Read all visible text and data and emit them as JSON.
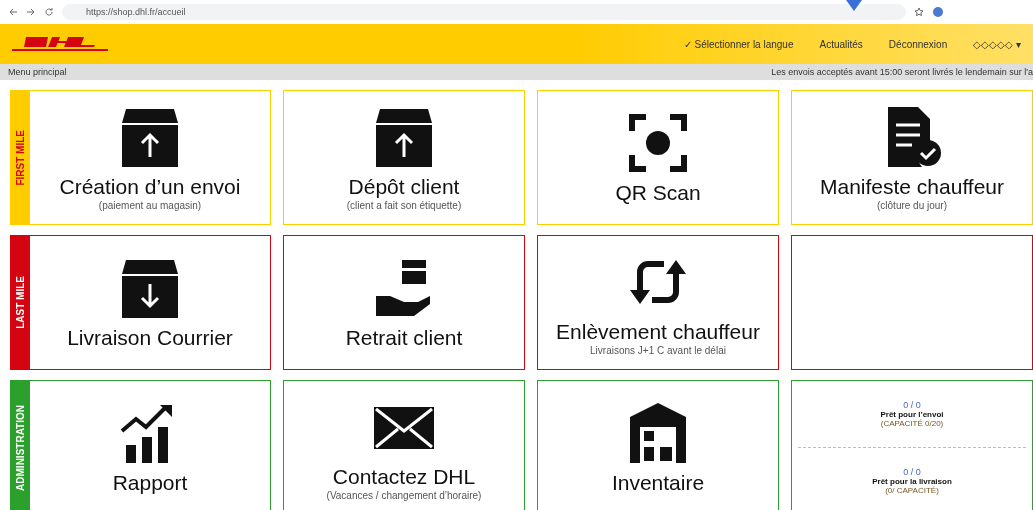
{
  "browser": {
    "url": "https://shop.dhl.fr/accueil"
  },
  "header": {
    "nav": [
      {
        "label": "✓ Sélectionner la langue"
      },
      {
        "label": "Actualités"
      },
      {
        "label": "Déconnexion"
      },
      {
        "label": "◇◇◇◇◇ ▾"
      }
    ]
  },
  "subbar": {
    "breadcrumb": "Menu principal",
    "notice": "Les envois acceptés avant 15:00 seront livrés le lendemain sur l'a"
  },
  "sections": [
    {
      "label": "FIRST MILE",
      "color": "#ffcc00",
      "cards": [
        {
          "kind": "action",
          "title": "Création d’un envoi",
          "subtitle": "(paiement au magasin)"
        },
        {
          "kind": "action",
          "title": "Dépôt client",
          "subtitle": "(client a fait son étiquette)"
        },
        {
          "kind": "action",
          "title": "QR Scan"
        },
        {
          "kind": "action",
          "title": "Manifeste chauffeur",
          "subtitle": "(clôture du jour)"
        }
      ]
    },
    {
      "label": "LAST MILE",
      "color": "#d40511",
      "cards": [
        {
          "kind": "action",
          "title": "Livraison Courrier"
        },
        {
          "kind": "action",
          "title": "Retrait client"
        },
        {
          "kind": "action",
          "title": "Enlèvement chauffeur",
          "subtitle": "Livraisons J+1 C avant le délai"
        },
        {
          "kind": "empty"
        }
      ]
    },
    {
      "label": "ADMINISTRATION",
      "color": "#2ca02c",
      "cards": [
        {
          "kind": "action",
          "title": "Rapport"
        },
        {
          "kind": "action",
          "title": "Contactez DHL",
          "subtitle": "(Vacances / changement d’horaire)"
        },
        {
          "kind": "action",
          "title": "Inventaire"
        },
        {
          "kind": "counters",
          "counters": [
            {
              "count": "0 / 0",
              "label": "Prêt pour l’envoi",
              "note": "(CAPACITÉ 0/20)"
            },
            {
              "count": "0 / 0",
              "label": "Prêt pour la livraison",
              "note": "(0/ CAPACITÉ)"
            }
          ]
        }
      ]
    }
  ]
}
